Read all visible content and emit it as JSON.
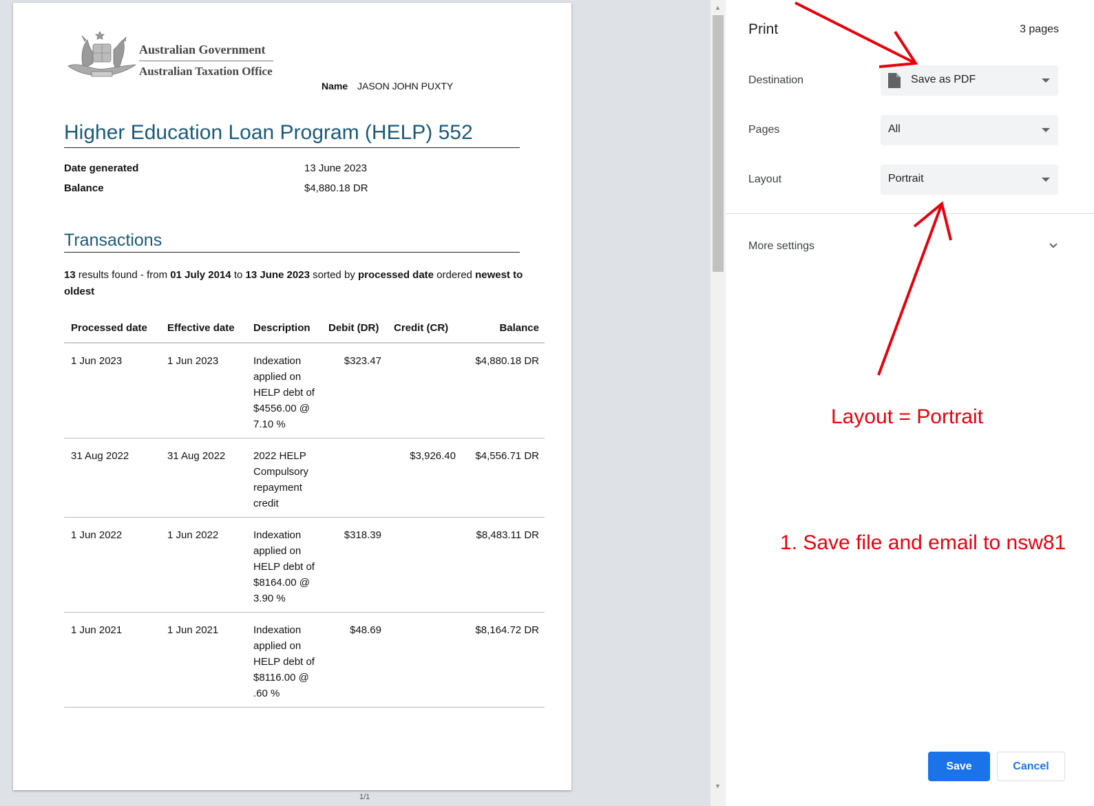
{
  "preview": {
    "page_number_label": "1/1",
    "header": {
      "gov_name": "Australian Government",
      "ato_name": "Australian Taxation Office",
      "name_label": "Name",
      "name_value": "JASON JOHN PUXTY"
    },
    "title": "Higher Education Loan Program (HELP) 552",
    "meta": [
      {
        "label": "Date generated",
        "value": "13 June 2023"
      },
      {
        "label": "Balance",
        "value": "$4,880.18 DR"
      }
    ],
    "transactions": {
      "title": "Transactions",
      "summary": {
        "count": "13",
        "t1": " results found - from ",
        "from": "01 July 2014",
        "t2": " to ",
        "to": "13 June 2023",
        "t3": " sorted by ",
        "sort": "processed date",
        "t4": " ordered ",
        "order": "newest to oldest"
      },
      "columns": [
        "Processed date",
        "Effective date",
        "Description",
        "Debit (DR)",
        "Credit (CR)",
        "Balance"
      ],
      "rows": [
        {
          "processed": "1 Jun 2023",
          "effective": "1 Jun 2023",
          "description": "Indexation applied on HELP debt of $4556.00 @ 7.10 %",
          "debit": "$323.47",
          "credit": "",
          "balance": "$4,880.18 DR"
        },
        {
          "processed": "31 Aug 2022",
          "effective": "31 Aug 2022",
          "description": "2022 HELP Compulsory repayment credit",
          "debit": "",
          "credit": "$3,926.40",
          "balance": "$4,556.71 DR"
        },
        {
          "processed": "1 Jun 2022",
          "effective": "1 Jun 2022",
          "description": "Indexation applied on HELP debt of $8164.00 @ 3.90 %",
          "debit": "$318.39",
          "credit": "",
          "balance": "$8,483.11 DR"
        },
        {
          "processed": "1 Jun 2021",
          "effective": "1 Jun 2021",
          "description": "Indexation applied on HELP debt of $8116.00 @ .60 %",
          "debit": "$48.69",
          "credit": "",
          "balance": "$8,164.72 DR"
        }
      ]
    }
  },
  "dialog": {
    "title": "Print",
    "page_count": "3 pages",
    "destination": {
      "label": "Destination",
      "value": "Save as PDF",
      "icon": "pdf-file-icon"
    },
    "pages": {
      "label": "Pages",
      "value": "All"
    },
    "layout": {
      "label": "Layout",
      "value": "Portrait"
    },
    "more_settings": "More settings",
    "save_label": "Save",
    "cancel_label": "Cancel"
  },
  "annotations": {
    "layout_note": "Layout = Portrait",
    "save_note": "1.  Save file and email to nsw81",
    "color": "#e8000b"
  },
  "colors": {
    "accent": "#1a73e8",
    "heading": "#1c5a78",
    "preview_background": "#dee1e6"
  }
}
